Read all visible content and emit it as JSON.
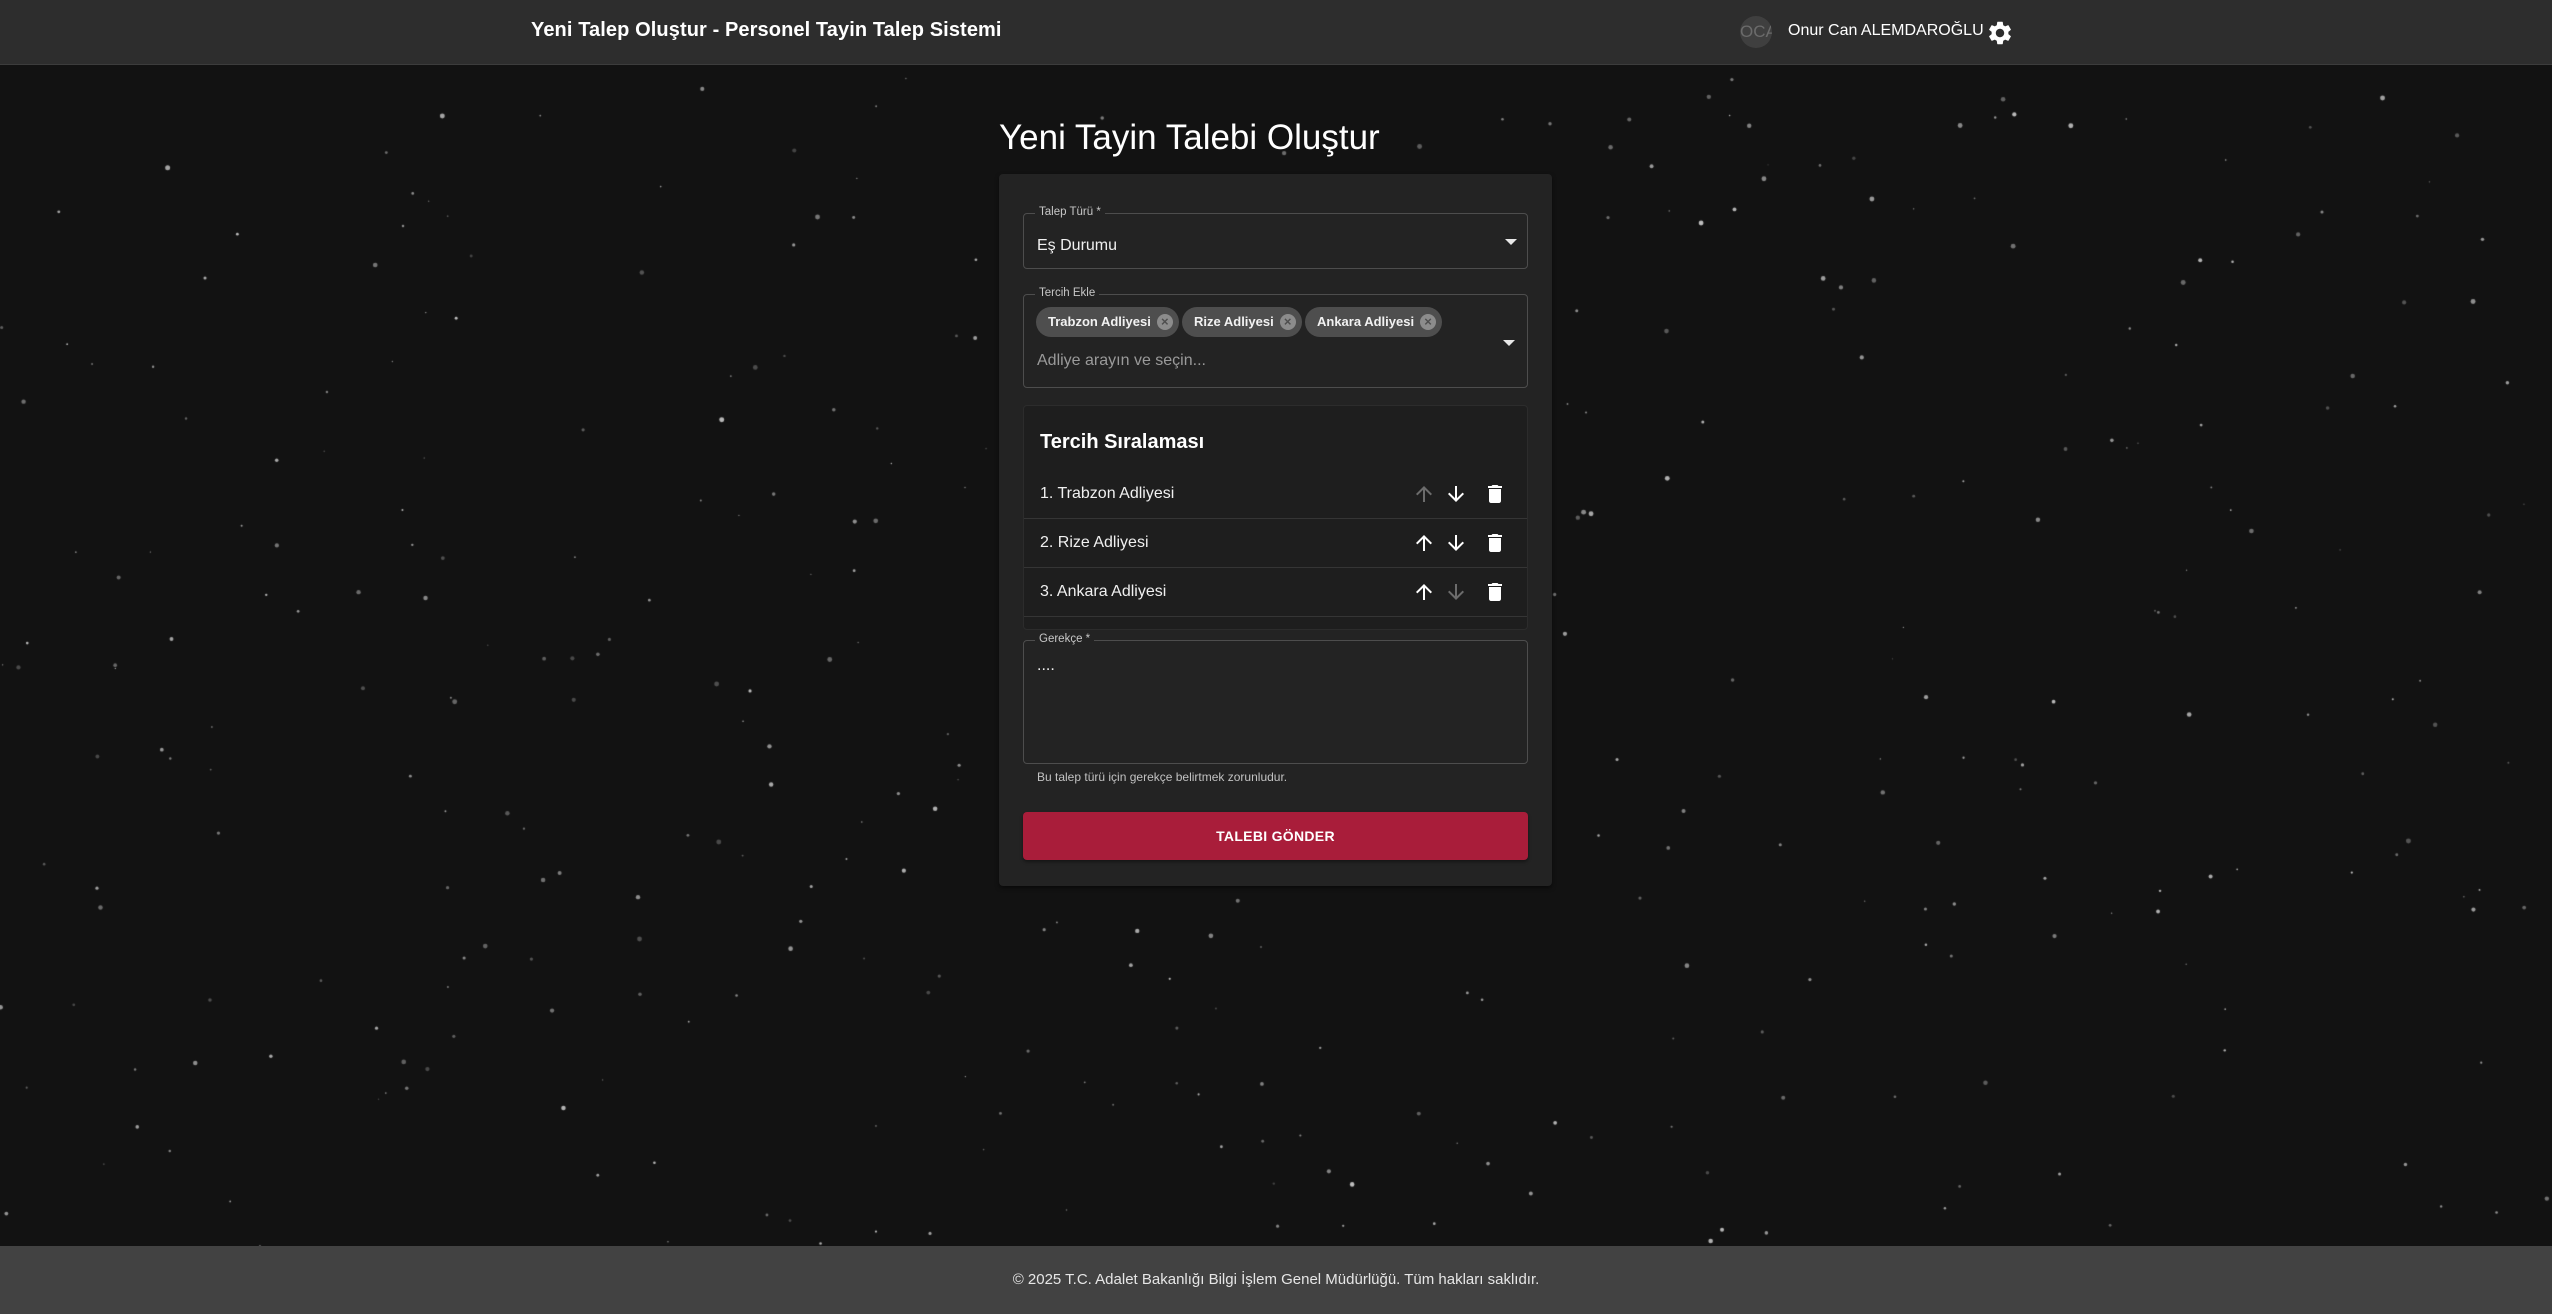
{
  "header": {
    "title": "Yeni Talep Oluştur - Personel Tayin Talep Sistemi",
    "avatar_initials": "OCA",
    "user_name": "Onur Can ALEMDAROĞLU",
    "settings_icon": "gear-icon"
  },
  "page": {
    "title": "Yeni Tayin Talebi Oluştur"
  },
  "form": {
    "request_type": {
      "label": "Talep Türü *",
      "value": "Eş Durumu"
    },
    "preference_add": {
      "label": "Tercih Ekle",
      "placeholder": "Adliye arayın ve seçin...",
      "chips": [
        "Trabzon Adliyesi",
        "Rize Adliyesi",
        "Ankara Adliyesi"
      ]
    },
    "ranking": {
      "title": "Tercih Sıralaması",
      "items": [
        {
          "label": "1. Trabzon Adliyesi",
          "up_enabled": false,
          "down_enabled": true
        },
        {
          "label": "2. Rize Adliyesi",
          "up_enabled": true,
          "down_enabled": true
        },
        {
          "label": "3. Ankara Adliyesi",
          "up_enabled": true,
          "down_enabled": false
        }
      ]
    },
    "justification": {
      "label": "Gerekçe *",
      "value": "....",
      "helper": "Bu talep türü için gerekçe belirtmek zorunludur."
    },
    "submit_label": "TALEBI GÖNDER"
  },
  "footer": {
    "text": "© 2025 T.C. Adalet Bakanlığı Bilgi İşlem Genel Müdürlüğü. Tüm hakları saklıdır."
  },
  "colors": {
    "appbar": "#2d2d2d",
    "background": "#121212",
    "card": "#232323",
    "accent": "#a91d3a",
    "footer": "#424242"
  }
}
